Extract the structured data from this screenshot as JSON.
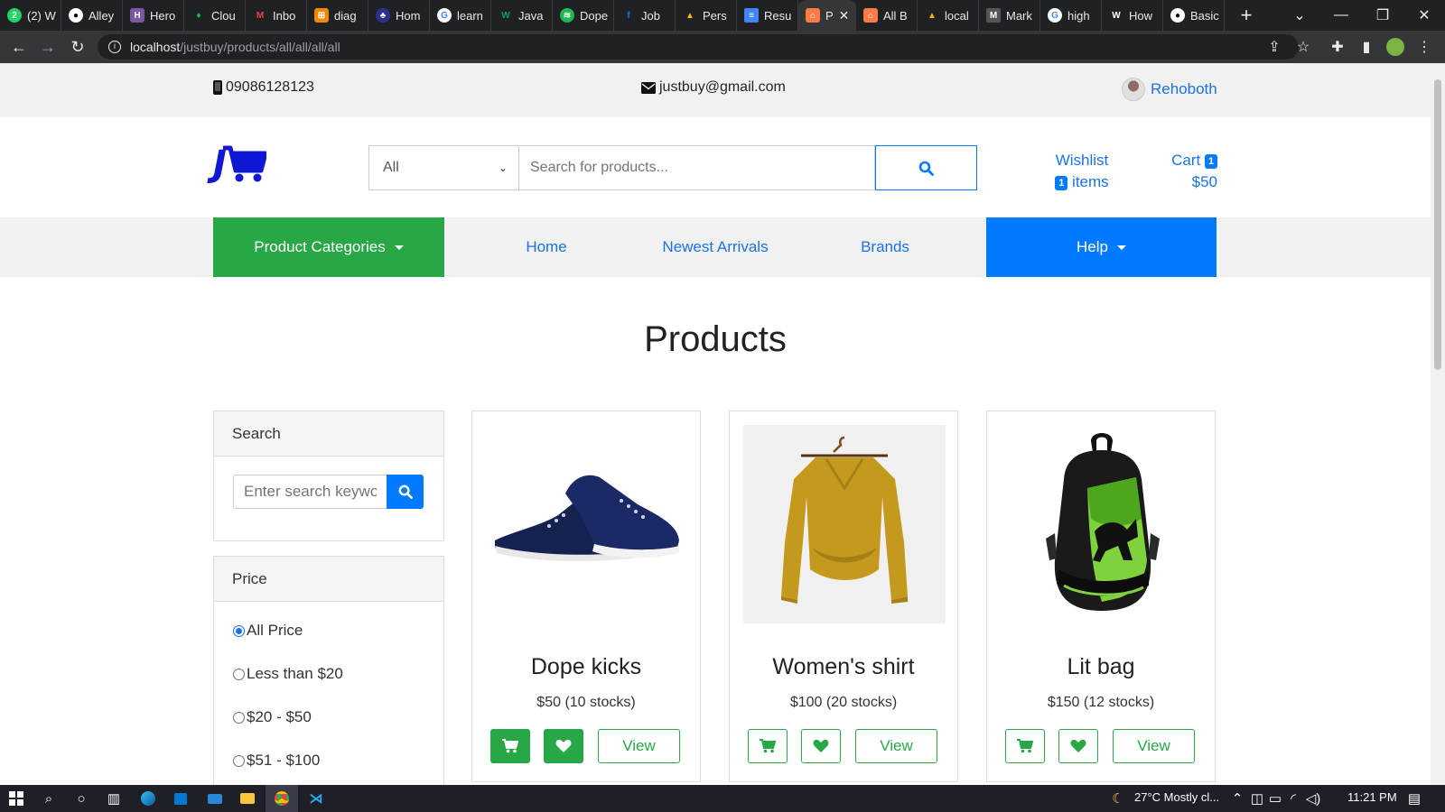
{
  "browser": {
    "tabs": [
      {
        "label": "(2) W",
        "color": "#25d366"
      },
      {
        "label": "Alley",
        "color": "#ffffff"
      },
      {
        "label": "Hero",
        "color": "#79589f"
      },
      {
        "label": "Clou",
        "color": "#00c853"
      },
      {
        "label": "Inbo",
        "color": "#ea4335"
      },
      {
        "label": "diag",
        "color": "#f08705"
      },
      {
        "label": "Hom",
        "color": "#2a2f8f"
      },
      {
        "label": "learn",
        "color": "#4285f4"
      },
      {
        "label": "Java",
        "color": "#0f9d58"
      },
      {
        "label": "Dope",
        "color": "#1db954"
      },
      {
        "label": "Job",
        "color": "#1877f2"
      },
      {
        "label": "Pers",
        "color": "#fbbc04"
      },
      {
        "label": "Resu",
        "color": "#4285f4"
      },
      {
        "label": "P",
        "color": "#ff7a45",
        "active": true
      },
      {
        "label": "All B",
        "color": "#ff7a45"
      },
      {
        "label": "local",
        "color": "#f4b400"
      },
      {
        "label": "Mark",
        "color": "#777777"
      },
      {
        "label": "high",
        "color": "#4285f4"
      },
      {
        "label": "How",
        "color": "#ffffff"
      },
      {
        "label": "Basic",
        "color": "#ffffff"
      }
    ],
    "url_host": "localhost",
    "url_path": "/justbuy/products/all/all/all/all"
  },
  "topbar": {
    "phone": "09086128123",
    "email": "justbuy@gmail.com",
    "user": "Rehoboth"
  },
  "header": {
    "logo_letter": "J",
    "category_select": "All",
    "search_placeholder": "Search for products...",
    "wishlist_label": "Wishlist",
    "wishlist_count": "1",
    "wishlist_items_label": "items",
    "cart_label": "Cart",
    "cart_count": "1",
    "cart_total": "$50"
  },
  "nav": {
    "categories": "Product Categories",
    "home": "Home",
    "newest": "Newest Arrivals",
    "brands": "Brands",
    "help": "Help"
  },
  "main": {
    "title": "Products"
  },
  "sidebar": {
    "search_title": "Search",
    "search_placeholder": "Enter search keyword",
    "price_title": "Price",
    "price_options": [
      "All Price",
      "Less than $20",
      "$20 - $50",
      "$51 - $100"
    ],
    "price_selected": "All Price"
  },
  "products": [
    {
      "name": "Dope kicks",
      "price": "$50 (10 stocks)",
      "view": "View",
      "image": "shoe"
    },
    {
      "name": "Women's shirt",
      "price": "$100 (20 stocks)",
      "view": "View",
      "image": "sweater"
    },
    {
      "name": "Lit bag",
      "price": "$150 (12 stocks)",
      "view": "View",
      "image": "backpack"
    }
  ],
  "colors": {
    "green": "#28a745",
    "blue": "#007bff",
    "link": "#1a73e8",
    "logo": "#1018d6"
  },
  "taskbar": {
    "weather": "27°C  Mostly cl...",
    "time": "11:21 PM"
  }
}
